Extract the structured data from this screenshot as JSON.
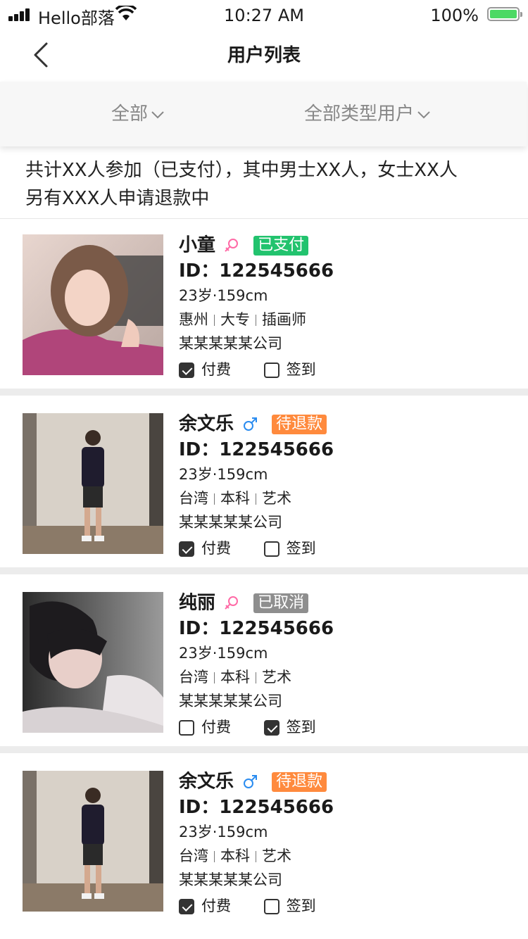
{
  "status_bar": {
    "carrier": "Hello部落",
    "time": "10:27 AM",
    "battery": "100%"
  },
  "nav": {
    "title": "用户列表"
  },
  "filters": [
    {
      "label": "全部"
    },
    {
      "label": "全部类型用户"
    }
  ],
  "summary": {
    "line1": "共计XX人参加（已支付），其中男士XX人，女士XX人",
    "line2": "另有XXX人申请退款中"
  },
  "colors": {
    "paid": "#22c36e",
    "refund": "#ff8a3d",
    "cancel": "#8e8e8e",
    "female": "#ff6aa6",
    "male": "#2a8cf0",
    "battery": "#4cd964"
  },
  "users": [
    {
      "name": "小童",
      "gender": "female",
      "gender_icon": "female-icon",
      "status": "已支付",
      "status_type": "paid",
      "id": "ID：122545666",
      "age_height": "23岁·159cm",
      "city": "惠州",
      "education": "大专",
      "job": "插画师",
      "company": "某某某某某公司",
      "pay_label": "付费",
      "pay_checked": true,
      "checkin_label": "签到",
      "checkin_checked": false
    },
    {
      "name": "余文乐",
      "gender": "male",
      "gender_icon": "male-icon",
      "status": "待退款",
      "status_type": "refund",
      "id": "ID：122545666",
      "age_height": "23岁·159cm",
      "city": "台湾",
      "education": "本科",
      "job": "艺术",
      "company": "某某某某某公司",
      "pay_label": "付费",
      "pay_checked": true,
      "checkin_label": "签到",
      "checkin_checked": false
    },
    {
      "name": "纯丽",
      "gender": "female",
      "gender_icon": "female-icon",
      "status": "已取消",
      "status_type": "cancel",
      "id": "ID：122545666",
      "age_height": "23岁·159cm",
      "city": "台湾",
      "education": "本科",
      "job": "艺术",
      "company": "某某某某某公司",
      "pay_label": "付费",
      "pay_checked": false,
      "checkin_label": "签到",
      "checkin_checked": true
    },
    {
      "name": "余文乐",
      "gender": "male",
      "gender_icon": "male-icon",
      "status": "待退款",
      "status_type": "refund",
      "id": "ID：122545666",
      "age_height": "23岁·159cm",
      "city": "台湾",
      "education": "本科",
      "job": "艺术",
      "company": "某某某某某公司",
      "pay_label": "付费",
      "pay_checked": true,
      "checkin_label": "签到",
      "checkin_checked": false
    }
  ]
}
